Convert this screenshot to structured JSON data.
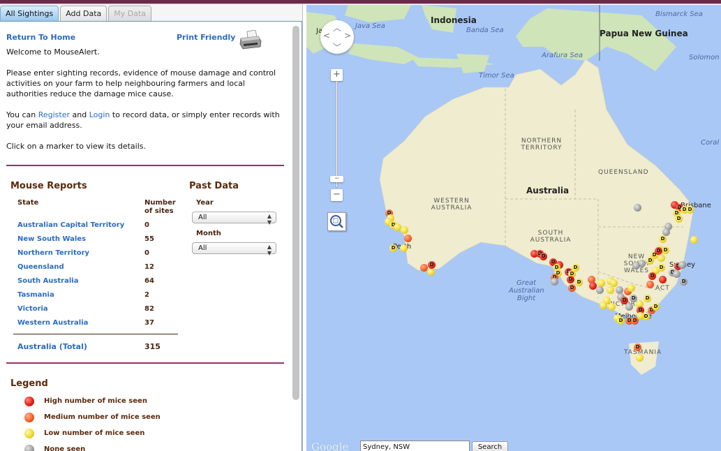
{
  "tabs": [
    {
      "label": "All Sightings",
      "state": "active"
    },
    {
      "label": "Add Data",
      "state": "normal"
    },
    {
      "label": "My Data",
      "state": "disabled"
    }
  ],
  "header": {
    "return_home": "Return To Home",
    "print_friendly": "Print Friendly"
  },
  "intro": {
    "welcome": "Welcome to MouseAlert.",
    "para1": "Please enter sighting records, evidence of mouse damage and control activities on your farm to help neighbouring farmers and local authorities reduce the damage mice cause.",
    "para2_pre": "You can ",
    "register": "Register",
    "para2_mid": " and ",
    "login": "Login",
    "para2_post": " to record data, or simply enter records with your email address.",
    "para3": "Click on a marker to view its details."
  },
  "reports": {
    "title": "Mouse Reports",
    "col_state": "State",
    "col_sites_1": "Number",
    "col_sites_2": "of sites",
    "rows": [
      {
        "state": "Australian Capital Territory",
        "sites": "0"
      },
      {
        "state": "New South Wales",
        "sites": "55"
      },
      {
        "state": "Northern Territory",
        "sites": "0"
      },
      {
        "state": "Queensland",
        "sites": "12"
      },
      {
        "state": "South Australia",
        "sites": "64"
      },
      {
        "state": "Tasmania",
        "sites": "2"
      },
      {
        "state": "Victoria",
        "sites": "82"
      },
      {
        "state": "Western Australia",
        "sites": "37"
      }
    ],
    "total_label": "Australia (Total)",
    "total_value": "315"
  },
  "past_data": {
    "title": "Past Data",
    "year_label": "Year",
    "year_value": "All",
    "month_label": "Month",
    "month_value": "All"
  },
  "legend": {
    "title": "Legend",
    "items": [
      {
        "label": "High number of mice seen",
        "level": "high",
        "color": "#e01a10"
      },
      {
        "label": "Medium number of mice seen",
        "level": "med",
        "color": "#f05a22"
      },
      {
        "label": "Low number of mice seen",
        "level": "low",
        "color": "#f1d52a"
      },
      {
        "label": "None seen",
        "level": "none",
        "color": "#9a9a9a"
      }
    ]
  },
  "map": {
    "labels": {
      "indonesia": "Indonesia",
      "java_sea": "Java Sea",
      "banda_sea": "Banda Sea",
      "bismarck_sea": "Bismarck Sea",
      "png": "Papua New Guinea",
      "arafura_sea": "Arafura Sea",
      "solomon": "Solomon",
      "timor_sea": "Timor Sea",
      "coral": "Coral",
      "nt": "NORTHERN TERRITORY",
      "qld": "QUEENSLAND",
      "australia": "Australia",
      "wa": "WESTERN AUSTRALIA",
      "sa": "SOUTH AUSTRALIA",
      "nsw": "NEW SOUTH WALES",
      "vic": "VICTORIA",
      "act": "ACT",
      "tas": "TASMANIA",
      "gab": "Great Australian Bight",
      "brisbane": "Brisbane",
      "sydney": "Sydney",
      "melbourne": "Melbourne",
      "perth": "Perth",
      "ja": "Ja"
    },
    "google": "Google",
    "search_value": "Sydney, NSW",
    "search_button": "Search",
    "marker_letter": "D"
  },
  "colors": {
    "accent_divider": "#9c2e67",
    "link": "#2a6cc2",
    "heading": "#5a2a0c",
    "water": "#a9c8f6",
    "land": "#efeccf"
  }
}
